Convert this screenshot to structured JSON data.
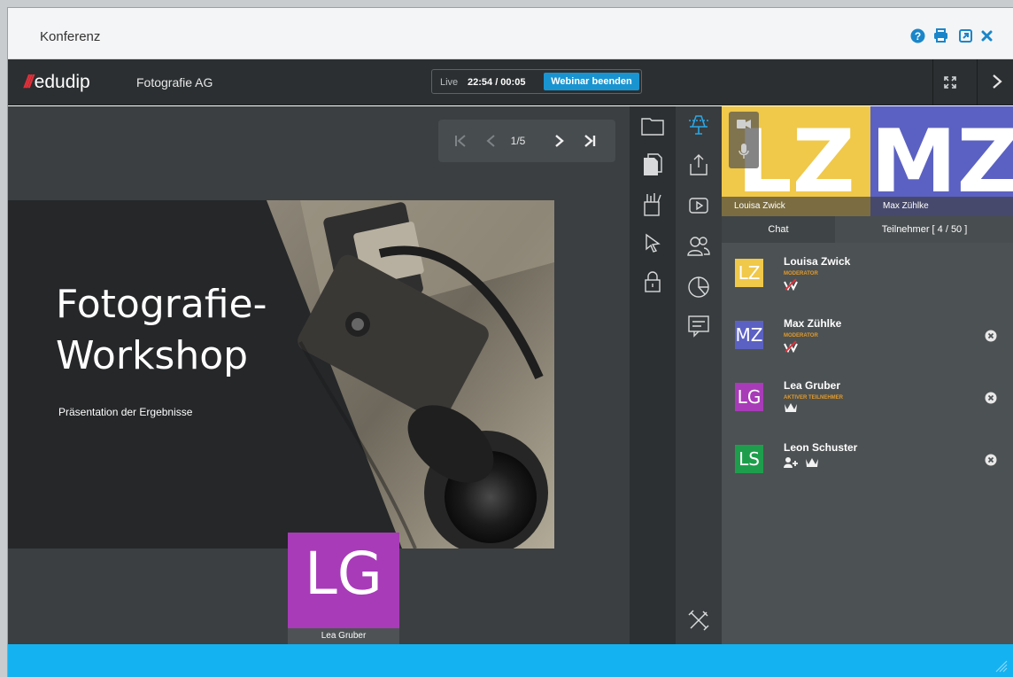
{
  "window": {
    "title": "Konferenz",
    "controls": [
      "help-icon",
      "print-icon",
      "popout-icon",
      "close-icon"
    ],
    "accent_color": "#1a86c9"
  },
  "appbar": {
    "logo_text": "edudip",
    "organization": "Fotografie AG",
    "live_label": "Live",
    "timer": "22:54 / 00:05",
    "end_button": "Webinar beenden",
    "end_button_color": "#1a94d1"
  },
  "pager": {
    "page": "1/5"
  },
  "slide": {
    "title_line1": "Fotografie-",
    "title_line2": "Workshop",
    "subtitle": "Präsentation der Ergebnisse"
  },
  "self_video": {
    "initials": "LG",
    "name": "Lea Gruber",
    "color": "#a83bb8"
  },
  "videos": [
    {
      "initials": "LZ",
      "name": "Louisa Zwick",
      "color": "#f0c84a"
    },
    {
      "initials": "MZ",
      "name": "Max Zühlke",
      "color": "#5b61c2"
    }
  ],
  "tabs": {
    "chat": "Chat",
    "participants": "Teilnehmer [ 4 / 50 ]"
  },
  "participants": [
    {
      "initials": "LZ",
      "name": "Louisa Zwick",
      "role": "Moderator",
      "color": "#f0c84a",
      "badges": [
        "moderator-badge-icon"
      ],
      "removable": false
    },
    {
      "initials": "MZ",
      "name": "Max Zühlke",
      "role": "Moderator",
      "color": "#5b61c2",
      "badges": [
        "moderator-badge-icon"
      ],
      "removable": true
    },
    {
      "initials": "LG",
      "name": "Lea Gruber",
      "role": "Aktiver Teilnehmer",
      "color": "#a83bb8",
      "badges": [
        "crown-icon"
      ],
      "removable": true
    },
    {
      "initials": "LS",
      "name": "Leon Schuster",
      "role": "",
      "color": "#1e9e4c",
      "badges": [
        "add-user-icon",
        "crown-icon"
      ],
      "removable": true
    }
  ],
  "tools_column_a": [
    "folder-icon",
    "documents-icon",
    "whiteboard-tools-icon",
    "pointer-icon",
    "lock-icon"
  ],
  "tools_column_b": [
    "presentation-icon",
    "upload-icon",
    "video-play-icon",
    "participants-icon",
    "poll-icon",
    "chat-survey-icon",
    "settings-tools-icon"
  ],
  "footer_color": "#14b2f0"
}
